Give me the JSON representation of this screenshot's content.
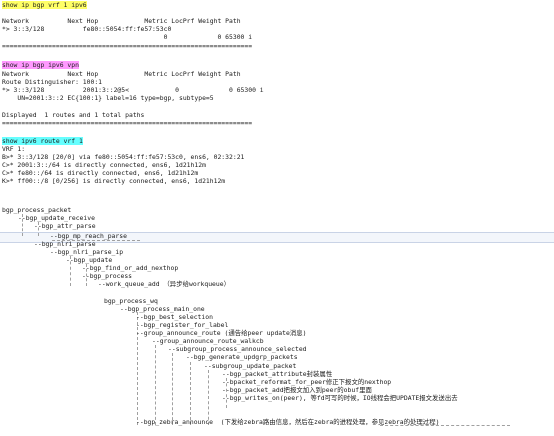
{
  "cmd1": "show ip bgp vrf 1 ipv6",
  "t1_header": "Network          Next Hop            Metric LocPrf Weight Path",
  "t1_row1": "*> 3::3/128          fe80::5054:ff:fe57:53c0",
  "t1_row2": "                                          0             0 65300 i",
  "sep": "=================================================================",
  "cmd2": "show ip bgp ipv6 vpn",
  "t2_header": "Network          Next Hop            Metric LocPrf Weight Path",
  "t2_rd": "Route Distinguisher: 100:1",
  "t2_row1": "*> 3::3/128          2001:3::2@5<            0             0 65300 i",
  "t2_row2": "    UN=2001:3::2 EC{100:1} label=16 type=bgp, subtype=5",
  "t2_displayed": "Displayed  1 routes and 1 total paths",
  "cmd3": "show ipv6 route vrf 1",
  "r_vrf": "VRF 1:",
  "r1": "B>* 3::3/128 [20/0] via fe80::5054:ff:fe57:53c0, ens6, 02:32:21",
  "r2": "C>* 2001:3::/64 is directly connected, ens6, 1d21h12m",
  "r3": "C>* fe80::/64 is directly connected, ens6, 1d21h12m",
  "r4": "K>* ff00::/8 [0/256] is directly connected, ens6, 1d21h12m",
  "tree": [
    "bgp_process_packet",
    "--bgp_update_receive",
    "--bgp_attr_parse",
    "--bgp_mp_reach_parse",
    "--bgp_nlri_parse",
    "--bgp_nlri_parse_ip",
    "--bgp_update",
    "--bgp_find_or_add_nexthop",
    "--bgp_process",
    "--work_queue_add （异步给workqueue）",
    "bgp_process_wq",
    "--bgp_process_main_one",
    "--bgp_best_selection",
    "--bgp_register_for_label",
    "--group_announce_route (通告给peer update消息)",
    "--group_announce_route_walkcb",
    "--subgroup_process_announce_selected",
    "--bgp_generate_updgrp_packets",
    "--subgroup_update_packet",
    "--bgp_packet_attribute封装属性",
    "--bpacket_reformat_for_peer修正下报文的nexthop",
    "--bgp_packet_add把报文加入到peer的obuf里面",
    "--bgp_writes_on(peer), 等fd可写的时候，IO线程会把UPDATE报文发送出去",
    "--bgp_zebra_announce  (下发给zebra路由信息，然后在zebra的进程处理，参见zebra的处理过程)"
  ]
}
